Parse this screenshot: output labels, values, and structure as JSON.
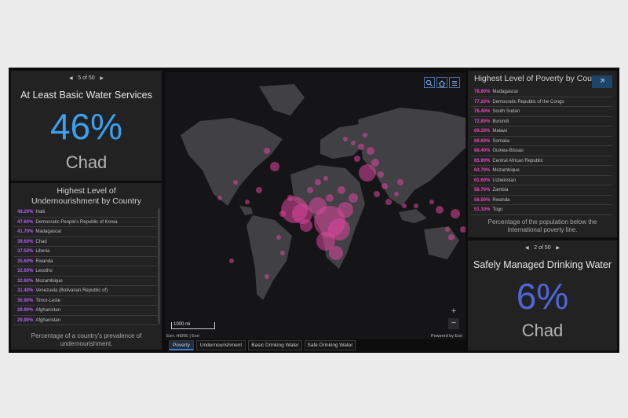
{
  "colors": {
    "water_accent": "#3aa0f0",
    "safe_water_accent": "#4f66d6",
    "undernourishment_accent": "#b45cf0",
    "poverty_accent": "#e24bb6",
    "map_bubble": "#e0469e"
  },
  "basic_water": {
    "pager": "5 of 50",
    "prev_icon": "triangle-left-icon",
    "next_icon": "triangle-right-icon",
    "title": "At Least Basic Water Services",
    "value": "46%",
    "country": "Chad"
  },
  "undernourishment": {
    "title": "Highest Level of Undernourishment by Country",
    "rows": [
      {
        "pct": "48.20%",
        "country": "Haiti"
      },
      {
        "pct": "47.60%",
        "country": "Democratic People's Republic of Korea"
      },
      {
        "pct": "41.70%",
        "country": "Madagascar"
      },
      {
        "pct": "39.60%",
        "country": "Chad"
      },
      {
        "pct": "37.50%",
        "country": "Liberia"
      },
      {
        "pct": "35.60%",
        "country": "Rwanda"
      },
      {
        "pct": "32.60%",
        "country": "Lesotho"
      },
      {
        "pct": "32.60%",
        "country": "Mozambique"
      },
      {
        "pct": "31.40%",
        "country": "Venezuela (Bolivarian Republic of)"
      },
      {
        "pct": "30.90%",
        "country": "Timor-Leste"
      },
      {
        "pct": "29.90%",
        "country": "Afghanistan"
      },
      {
        "pct": "29.90%",
        "country": "Afghanistan"
      }
    ],
    "footer": "Percentage of a country's prevalence of undernourishment."
  },
  "map": {
    "scale_label": "1000 mi",
    "attribution": "Esri, HERE | Esri",
    "powered_by": "Powered by Esri",
    "zoom_in": "+",
    "zoom_out": "−",
    "tools": [
      "search-icon",
      "home-icon",
      "legend-list-icon"
    ]
  },
  "tabs": [
    {
      "label": "Poverty",
      "active": true
    },
    {
      "label": "Undernourishment",
      "active": false
    },
    {
      "label": "Basic Drinking Water",
      "active": false
    },
    {
      "label": "Safe Drinking Water",
      "active": false
    }
  ],
  "poverty": {
    "title": "Highest Level of Poverty by Country",
    "expand_icon": "expand-icon",
    "rows": [
      {
        "pct": "78.80%",
        "country": "Madagascar"
      },
      {
        "pct": "77.20%",
        "country": "Democratic Republic of the Congo"
      },
      {
        "pct": "76.40%",
        "country": "South Sudan"
      },
      {
        "pct": "72.80%",
        "country": "Burundi"
      },
      {
        "pct": "69.20%",
        "country": "Malawi"
      },
      {
        "pct": "68.60%",
        "country": "Somalia"
      },
      {
        "pct": "68.40%",
        "country": "Guinea-Bissau"
      },
      {
        "pct": "65.90%",
        "country": "Central African Republic"
      },
      {
        "pct": "63.70%",
        "country": "Mozambique"
      },
      {
        "pct": "61.60%",
        "country": "Uzbekistan"
      },
      {
        "pct": "58.70%",
        "country": "Zambia"
      },
      {
        "pct": "56.50%",
        "country": "Rwanda"
      },
      {
        "pct": "51.10%",
        "country": "Togo"
      }
    ],
    "footer": "Percentage of the population below the international poverty line."
  },
  "safe_water": {
    "pager": "2 of 50",
    "prev_icon": "triangle-left-icon",
    "next_icon": "triangle-right-icon",
    "title": "Safely Managed Drinking Water",
    "value": "6%",
    "country": "Chad"
  }
}
